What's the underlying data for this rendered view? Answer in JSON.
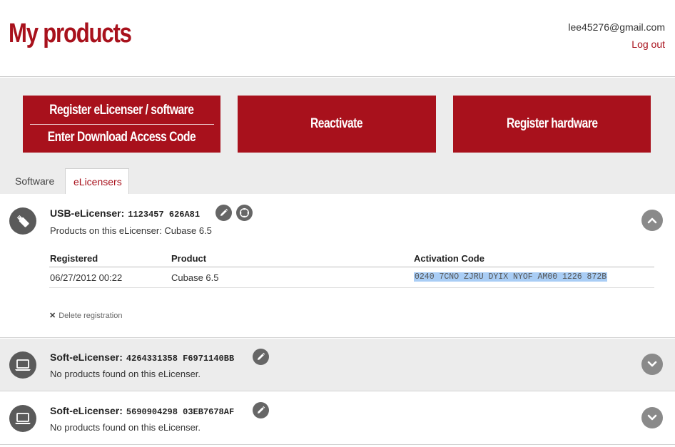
{
  "header": {
    "title": "My products",
    "user_email": "lee45276@gmail.com",
    "logout_label": "Log out"
  },
  "actions": {
    "register_line1": "Register eLicenser / software",
    "register_line2": "Enter Download Access Code",
    "reactivate": "Reactivate",
    "register_hardware": "Register hardware"
  },
  "tabs": [
    {
      "label": "Software",
      "active": false
    },
    {
      "label": "eLicensers",
      "active": true
    }
  ],
  "licensers": [
    {
      "type_label": "USB-eLicenser:",
      "id": "1123457 626A81",
      "subtitle": "Products on this eLicenser: Cubase 6.5",
      "icon": "usb-stick-icon",
      "expanded": true,
      "table": {
        "headers": [
          "Registered",
          "Product",
          "Activation Code"
        ],
        "rows": [
          {
            "registered": "06/27/2012 00:22",
            "product": "Cubase 6.5",
            "activation_code": "0240 7CNO ZJRU DYIX NYOF AM00 1226 872B"
          }
        ]
      },
      "delete_label": "Delete registration"
    },
    {
      "type_label": "Soft-eLicenser:",
      "id": "4264331358 F6971140BB",
      "subtitle": "No products found on this eLicenser.",
      "icon": "laptop-icon",
      "expanded": false
    },
    {
      "type_label": "Soft-eLicenser:",
      "id": "5690904298 03EB7678AF",
      "subtitle": "No products found on this eLicenser.",
      "icon": "laptop-icon",
      "expanded": false
    }
  ],
  "colors": {
    "brand_red": "#a8111c",
    "band_gray": "#ececec",
    "icon_gray": "#5a5a5a",
    "selection_blue": "#a9cdf5"
  }
}
